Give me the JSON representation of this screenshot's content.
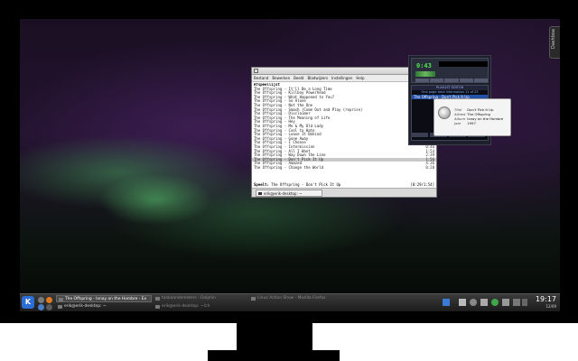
{
  "terminal": {
    "menu": [
      "Bestand",
      "Bewerken",
      "Beeld",
      "Bladwijzers",
      "Instellingen",
      "Help"
    ],
    "header": "Afspeellijst",
    "lines": [
      {
        "text": "The Offspring - It'll Be a Long Time",
        "duration": ""
      },
      {
        "text": "The Offspring - Killboy Powerhead",
        "duration": ""
      },
      {
        "text": "The Offspring - What Happened to You?",
        "duration": ""
      },
      {
        "text": "The Offspring - So Alone",
        "duration": ""
      },
      {
        "text": "The Offspring - Not the One",
        "duration": ""
      },
      {
        "text": "The Offspring - Smash (Come Out and Play (reprise)",
        "duration": ""
      },
      {
        "text": "The Offspring - Disclaimer",
        "duration": ""
      },
      {
        "text": "The Offspring - The Meaning of Life",
        "duration": ""
      },
      {
        "text": "The Offspring - Hey",
        "duration": ""
      },
      {
        "text": "The Offspring - Me & My Old Lady",
        "duration": ""
      },
      {
        "text": "The Offspring - Cool to Hate",
        "duration": ""
      },
      {
        "text": "The Offspring - Leave It Behind",
        "duration": ""
      },
      {
        "text": "The Offspring - Gone Away",
        "duration": ""
      },
      {
        "text": "The Offspring - I Choose",
        "duration": ""
      },
      {
        "text": "The Offspring - Intermission",
        "duration": "0:46"
      },
      {
        "text": "The Offspring - All I Want",
        "duration": "1:54"
      },
      {
        "text": "The Offspring - Way Down the Line",
        "duration": "2:39"
      },
      {
        "text": "The Offspring - Don't Pick It Up",
        "duration": "1:56",
        "selected": true
      },
      {
        "text": "The Offspring - Amazed",
        "duration": "4:36"
      },
      {
        "text": "The Offspring - Change the World",
        "duration": "0:20"
      }
    ],
    "status_label": "Speelt:",
    "status_track": "The Offspring - Don't Pick It Up",
    "status_position": "[0:29/1:54]",
    "tab_label": "erik@erik-desktop: ~"
  },
  "player": {
    "time": "0:43",
    "playlist_title": "PLAYLIST EDITOR",
    "playlist_info": "One page total information 11 of 23",
    "playlist_item": "The Offspring - Don't Pick It Up"
  },
  "tooltip": {
    "title_key": "Titel",
    "title_val": "Don't Pick It Up",
    "artist_key": "Artiest",
    "artist_val": "The Offspring",
    "album_key": "Album",
    "album_val": "Ixnay on the Hombre",
    "year_key": "Jaar",
    "year_val": "1997"
  },
  "taskbar": {
    "tasks": [
      {
        "label": "The Offspring - Ixnay on the Hombre - Ex",
        "active": true
      },
      {
        "label": "taakaandemeters - Dolphin",
        "active": false
      },
      {
        "label": "Linux Action Show - Mozilla Firefox",
        "active": false
      },
      {
        "label": "erik@erik-desktop: ~",
        "active": false
      },
      {
        "label": "erik@erik-desktop: ~/ch",
        "active": false
      }
    ],
    "clock_time": "19:17",
    "clock_date": "12/09"
  },
  "dashboard_label": "Dashboa",
  "colors": {
    "taskbar_bg": "#2a2a2a",
    "player_time": "#4fe34f",
    "playlist_selected": "#2350a8",
    "kmenu": "#2b6fd6"
  }
}
